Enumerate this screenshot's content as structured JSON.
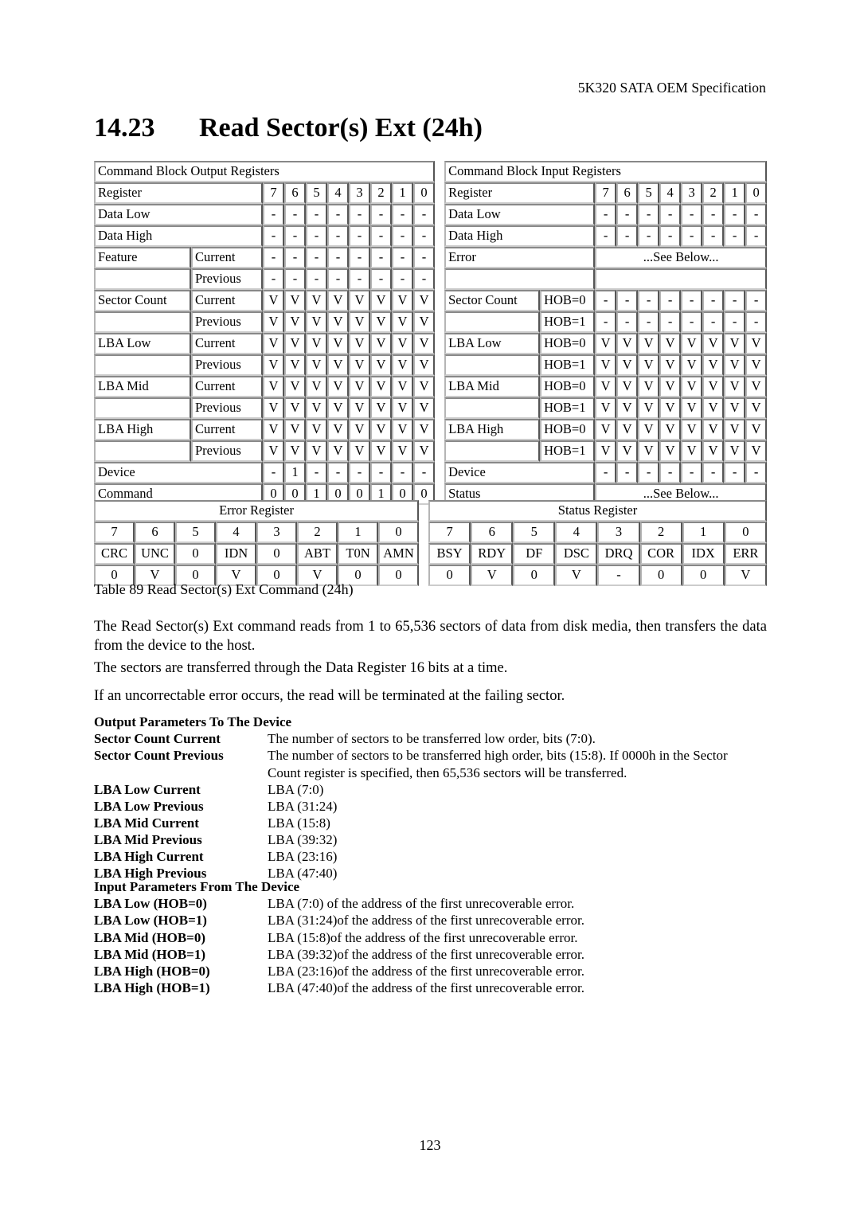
{
  "header": {
    "running_head": "5K320 SATA OEM Specification"
  },
  "title": {
    "number": "14.23",
    "text": "Read Sector(s) Ext (24h)"
  },
  "output_table": {
    "header": "Command Block Output Registers",
    "bit_header_label": "Register",
    "bits": [
      "7",
      "6",
      "5",
      "4",
      "3",
      "2",
      "1",
      "0"
    ],
    "rows": [
      {
        "name": "Data Low",
        "sub": "",
        "values": [
          "-",
          "-",
          "-",
          "-",
          "-",
          "-",
          "-",
          "-"
        ]
      },
      {
        "name": "Data High",
        "sub": "",
        "values": [
          "-",
          "-",
          "-",
          "-",
          "-",
          "-",
          "-",
          "-"
        ]
      },
      {
        "name": "Feature",
        "sub": "Current",
        "values": [
          "-",
          "-",
          "-",
          "-",
          "-",
          "-",
          "-",
          "-"
        ]
      },
      {
        "name": "",
        "sub": "Previous",
        "values": [
          "-",
          "-",
          "-",
          "-",
          "-",
          "-",
          "-",
          "-"
        ]
      },
      {
        "name": "Sector Count",
        "sub": "Current",
        "values": [
          "V",
          "V",
          "V",
          "V",
          "V",
          "V",
          "V",
          "V"
        ]
      },
      {
        "name": "",
        "sub": "Previous",
        "values": [
          "V",
          "V",
          "V",
          "V",
          "V",
          "V",
          "V",
          "V"
        ]
      },
      {
        "name": "LBA Low",
        "sub": "Current",
        "values": [
          "V",
          "V",
          "V",
          "V",
          "V",
          "V",
          "V",
          "V"
        ]
      },
      {
        "name": "",
        "sub": "Previous",
        "values": [
          "V",
          "V",
          "V",
          "V",
          "V",
          "V",
          "V",
          "V"
        ]
      },
      {
        "name": "LBA Mid",
        "sub": "Current",
        "values": [
          "V",
          "V",
          "V",
          "V",
          "V",
          "V",
          "V",
          "V"
        ]
      },
      {
        "name": "",
        "sub": "Previous",
        "values": [
          "V",
          "V",
          "V",
          "V",
          "V",
          "V",
          "V",
          "V"
        ]
      },
      {
        "name": "LBA High",
        "sub": "Current",
        "values": [
          "V",
          "V",
          "V",
          "V",
          "V",
          "V",
          "V",
          "V"
        ]
      },
      {
        "name": "",
        "sub": "Previous",
        "values": [
          "V",
          "V",
          "V",
          "V",
          "V",
          "V",
          "V",
          "V"
        ]
      },
      {
        "name": "Device",
        "sub": "",
        "values": [
          "-",
          "1",
          "-",
          "-",
          "-",
          "-",
          "-",
          "-"
        ]
      },
      {
        "name": "Command",
        "sub": "",
        "values": [
          "0",
          "0",
          "1",
          "0",
          "0",
          "1",
          "0",
          "0"
        ]
      }
    ]
  },
  "input_table": {
    "header": "Command Block Input Registers",
    "bit_header_label": "Register",
    "bits": [
      "7",
      "6",
      "5",
      "4",
      "3",
      "2",
      "1",
      "0"
    ],
    "see_below": "...See Below...",
    "rows": [
      {
        "name": "Data Low",
        "sub": "",
        "values": [
          "-",
          "-",
          "-",
          "-",
          "-",
          "-",
          "-",
          "-"
        ]
      },
      {
        "name": "Data High",
        "sub": "",
        "values": [
          "-",
          "-",
          "-",
          "-",
          "-",
          "-",
          "-",
          "-"
        ]
      },
      {
        "name": "Error",
        "sub": "",
        "span": "...See Below..."
      },
      {
        "name": "",
        "sub": "",
        "span": ""
      },
      {
        "name": "Sector Count",
        "sub": "HOB=0",
        "values": [
          "-",
          "-",
          "-",
          "-",
          "-",
          "-",
          "-",
          "-"
        ]
      },
      {
        "name": "",
        "sub": "HOB=1",
        "values": [
          "-",
          "-",
          "-",
          "-",
          "-",
          "-",
          "-",
          "-"
        ]
      },
      {
        "name": "LBA Low",
        "sub": "HOB=0",
        "values": [
          "V",
          "V",
          "V",
          "V",
          "V",
          "V",
          "V",
          "V"
        ]
      },
      {
        "name": "",
        "sub": "HOB=1",
        "values": [
          "V",
          "V",
          "V",
          "V",
          "V",
          "V",
          "V",
          "V"
        ]
      },
      {
        "name": "LBA Mid",
        "sub": "HOB=0",
        "values": [
          "V",
          "V",
          "V",
          "V",
          "V",
          "V",
          "V",
          "V"
        ]
      },
      {
        "name": "",
        "sub": "HOB=1",
        "values": [
          "V",
          "V",
          "V",
          "V",
          "V",
          "V",
          "V",
          "V"
        ]
      },
      {
        "name": "LBA High",
        "sub": "HOB=0",
        "values": [
          "V",
          "V",
          "V",
          "V",
          "V",
          "V",
          "V",
          "V"
        ]
      },
      {
        "name": "",
        "sub": "HOB=1",
        "values": [
          "V",
          "V",
          "V",
          "V",
          "V",
          "V",
          "V",
          "V"
        ]
      },
      {
        "name": "Device",
        "sub": "",
        "values": [
          "-",
          "-",
          "-",
          "-",
          "-",
          "-",
          "-",
          "-"
        ]
      },
      {
        "name": "Status",
        "sub": "",
        "span": "...See Below..."
      }
    ]
  },
  "error_register": {
    "title": "Error Register",
    "bits": [
      "7",
      "6",
      "5",
      "4",
      "3",
      "2",
      "1",
      "0"
    ],
    "names": [
      "CRC",
      "UNC",
      "0",
      "IDN",
      "0",
      "ABT",
      "T0N",
      "AMN"
    ],
    "values": [
      "0",
      "V",
      "0",
      "V",
      "0",
      "V",
      "0",
      "0"
    ]
  },
  "status_register": {
    "title": "Status Register",
    "bits": [
      "7",
      "6",
      "5",
      "4",
      "3",
      "2",
      "1",
      "0"
    ],
    "names": [
      "BSY",
      "RDY",
      "DF",
      "DSC",
      "DRQ",
      "COR",
      "IDX",
      "ERR"
    ],
    "values": [
      "0",
      "V",
      "0",
      "V",
      "-",
      "0",
      "0",
      "V"
    ]
  },
  "caption": "Table 89 Read Sector(s) Ext Command (24h)",
  "paragraphs": {
    "p1": "The Read Sector(s) Ext command reads from 1 to 65,536 sectors of data from disk media, then transfers the data from the device to the host.",
    "p2": "The sectors are transferred through the Data Register 16 bits at a time.",
    "p3": "If an uncorrectable error occurs, the read will be terminated at the failing sector."
  },
  "output_parameters": {
    "heading": "Output Parameters To The Device",
    "items": [
      {
        "term": "Sector Count Current",
        "def": "The number of sectors to be transferred low order, bits (7:0).",
        "cont": ""
      },
      {
        "term": "Sector Count Previous",
        "def": "The number of sectors to be transferred high order, bits (15:8). If 0000h in the Sector",
        "cont": "Count register is specified, then 65,536 sectors will be transferred."
      },
      {
        "term": "LBA Low Current",
        "def": "LBA (7:0)",
        "cont": ""
      },
      {
        "term": "LBA Low Previous",
        "def": "LBA (31:24)",
        "cont": ""
      },
      {
        "term": "LBA Mid Current",
        "def": "LBA (15:8)",
        "cont": ""
      },
      {
        "term": "LBA Mid Previous",
        "def": "LBA (39:32)",
        "cont": ""
      },
      {
        "term": "LBA High Current",
        "def": "LBA (23:16)",
        "cont": ""
      },
      {
        "term": "LBA High Previous",
        "def": "LBA (47:40)",
        "cont": ""
      }
    ]
  },
  "input_parameters": {
    "heading": "Input Parameters From The Device",
    "items": [
      {
        "term": "LBA Low (HOB=0)",
        "def": "LBA (7:0) of the address of the first unrecoverable error.",
        "cont": ""
      },
      {
        "term": "LBA Low (HOB=1)",
        "def": "LBA (31:24)of the address of the first unrecoverable error.",
        "cont": ""
      },
      {
        "term": "LBA Mid (HOB=0)",
        "def": "LBA (15:8)of the address of the first unrecoverable error.",
        "cont": ""
      },
      {
        "term": "LBA Mid (HOB=1)",
        "def": "LBA (39:32)of the address of the first unrecoverable error.",
        "cont": ""
      },
      {
        "term": "LBA High (HOB=0)",
        "def": "LBA (23:16)of the address of the first unrecoverable error.",
        "cont": ""
      },
      {
        "term": "LBA High (HOB=1)",
        "def": "LBA (47:40)of the address of the first unrecoverable error.",
        "cont": ""
      }
    ]
  },
  "footer": {
    "page_number": "123"
  }
}
